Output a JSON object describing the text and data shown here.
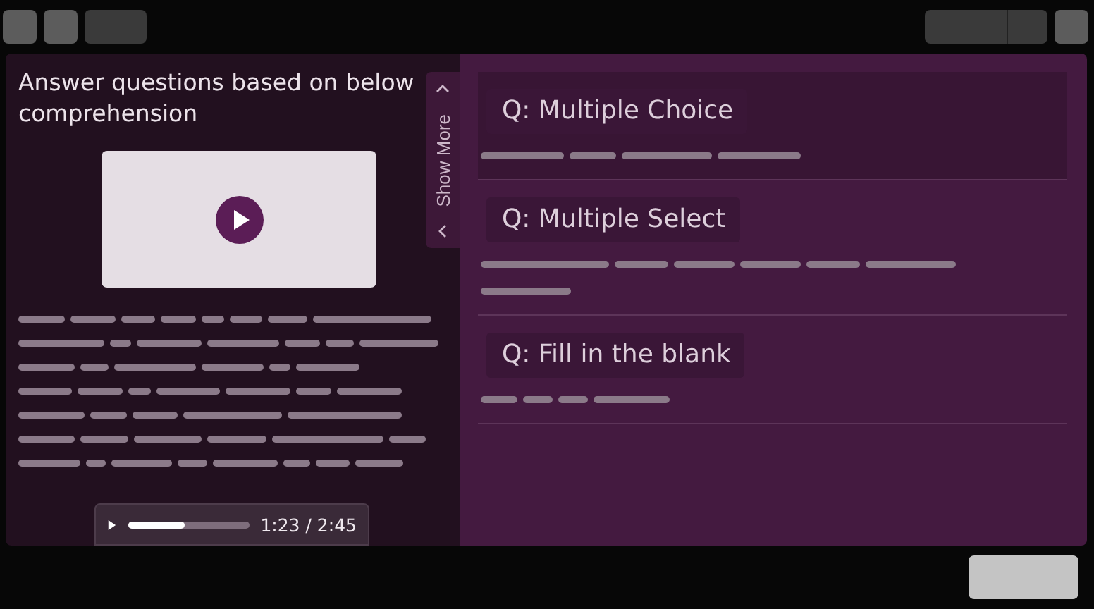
{
  "passage": {
    "title": "Answer questions based on below comprehension"
  },
  "audio": {
    "level": 0.47,
    "time": "1:23 / 2:45"
  },
  "side_tab": {
    "label": "Show More"
  },
  "questions": [
    {
      "title": "Q: Multiple Choice",
      "selected": true
    },
    {
      "title": "Q: Multiple Select",
      "selected": false
    },
    {
      "title": "Q: Fill in the blank",
      "selected": false
    }
  ]
}
